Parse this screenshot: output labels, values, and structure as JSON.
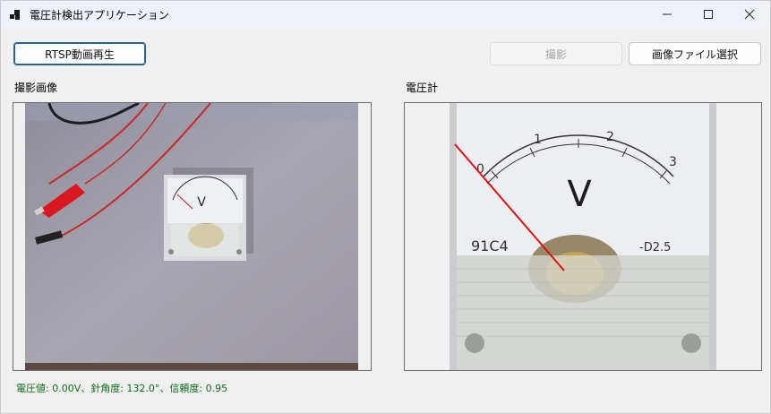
{
  "window": {
    "title": "電圧計検出アプリケーション"
  },
  "toolbar": {
    "rtsp_label": "RTSP動画再生",
    "capture_label": "撮影",
    "select_image_label": "画像ファイル選択"
  },
  "panels": {
    "captured_label": "撮影画像",
    "voltmeter_label": "電圧計"
  },
  "meter": {
    "scale_ticks": [
      "0",
      "1",
      "2",
      "3"
    ],
    "unit_letter": "V",
    "model_text": "91C4",
    "class_text": "-D2.5"
  },
  "status": {
    "text": "電圧値: 0.00V、針角度: 132.0°、信頼度: 0.95"
  },
  "colors": {
    "accent": "#2a5f9e",
    "status_text": "#0d6b1a",
    "needle": "#e01010"
  }
}
